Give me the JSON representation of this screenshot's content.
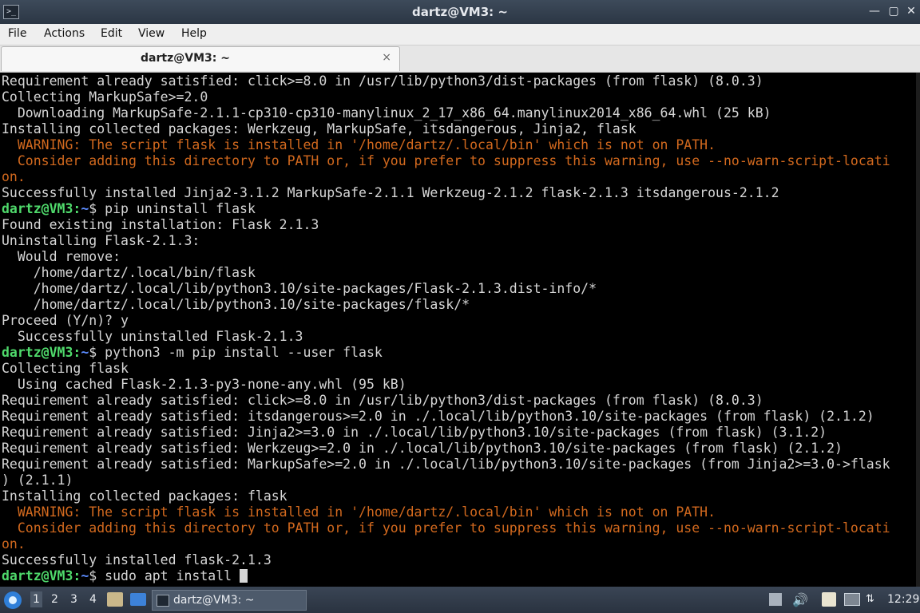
{
  "window": {
    "title": "dartz@VM3: ~",
    "minimize_label": "—",
    "maximize_label": "▢",
    "close_label": "✕"
  },
  "menu": [
    "File",
    "Actions",
    "Edit",
    "View",
    "Help"
  ],
  "tab": {
    "label": "dartz@VM3: ~",
    "close_label": "×"
  },
  "terminal": {
    "prompt_user": "dartz@VM3:",
    "prompt_path": "~",
    "lines": [
      {
        "t": "text",
        "s": "Requirement already satisfied: click>=8.0 in /usr/lib/python3/dist-packages (from flask) (8.0.3)"
      },
      {
        "t": "text",
        "s": "Collecting MarkupSafe>=2.0"
      },
      {
        "t": "text",
        "s": "  Downloading MarkupSafe-2.1.1-cp310-cp310-manylinux_2_17_x86_64.manylinux2014_x86_64.whl (25 kB)"
      },
      {
        "t": "text",
        "s": "Installing collected packages: Werkzeug, MarkupSafe, itsdangerous, Jinja2, flask"
      },
      {
        "t": "warn",
        "s": "  WARNING: The script flask is installed in '/home/dartz/.local/bin' which is not on PATH."
      },
      {
        "t": "warn",
        "s": "  Consider adding this directory to PATH or, if you prefer to suppress this warning, use --no-warn-script-locati"
      },
      {
        "t": "warn",
        "s": "on."
      },
      {
        "t": "text",
        "s": "Successfully installed Jinja2-3.1.2 MarkupSafe-2.1.1 Werkzeug-2.1.2 flask-2.1.3 itsdangerous-2.1.2"
      },
      {
        "t": "prompt",
        "s": "$ pip uninstall flask"
      },
      {
        "t": "text",
        "s": "Found existing installation: Flask 2.1.3"
      },
      {
        "t": "text",
        "s": "Uninstalling Flask-2.1.3:"
      },
      {
        "t": "text",
        "s": "  Would remove:"
      },
      {
        "t": "text",
        "s": "    /home/dartz/.local/bin/flask"
      },
      {
        "t": "text",
        "s": "    /home/dartz/.local/lib/python3.10/site-packages/Flask-2.1.3.dist-info/*"
      },
      {
        "t": "text",
        "s": "    /home/dartz/.local/lib/python3.10/site-packages/flask/*"
      },
      {
        "t": "text",
        "s": "Proceed (Y/n)? y"
      },
      {
        "t": "text",
        "s": "  Successfully uninstalled Flask-2.1.3"
      },
      {
        "t": "prompt",
        "s": "$ python3 -m pip install --user flask"
      },
      {
        "t": "text",
        "s": "Collecting flask"
      },
      {
        "t": "text",
        "s": "  Using cached Flask-2.1.3-py3-none-any.whl (95 kB)"
      },
      {
        "t": "text",
        "s": "Requirement already satisfied: click>=8.0 in /usr/lib/python3/dist-packages (from flask) (8.0.3)"
      },
      {
        "t": "text",
        "s": "Requirement already satisfied: itsdangerous>=2.0 in ./.local/lib/python3.10/site-packages (from flask) (2.1.2)"
      },
      {
        "t": "text",
        "s": "Requirement already satisfied: Jinja2>=3.0 in ./.local/lib/python3.10/site-packages (from flask) (3.1.2)"
      },
      {
        "t": "text",
        "s": "Requirement already satisfied: Werkzeug>=2.0 in ./.local/lib/python3.10/site-packages (from flask) (2.1.2)"
      },
      {
        "t": "text",
        "s": "Requirement already satisfied: MarkupSafe>=2.0 in ./.local/lib/python3.10/site-packages (from Jinja2>=3.0->flask"
      },
      {
        "t": "text",
        "s": ") (2.1.1)"
      },
      {
        "t": "text",
        "s": "Installing collected packages: flask"
      },
      {
        "t": "warn",
        "s": "  WARNING: The script flask is installed in '/home/dartz/.local/bin' which is not on PATH."
      },
      {
        "t": "warn",
        "s": "  Consider adding this directory to PATH or, if you prefer to suppress this warning, use --no-warn-script-locati"
      },
      {
        "t": "warn",
        "s": "on."
      },
      {
        "t": "text",
        "s": "Successfully installed flask-2.1.3"
      },
      {
        "t": "prompt_cursor",
        "s": "$ sudo apt install "
      }
    ]
  },
  "taskbar": {
    "workspaces": [
      "1",
      "2",
      "3",
      "4"
    ],
    "active_workspace": "1",
    "window_label": "dartz@VM3: ~",
    "clock": "12:29",
    "icons": [
      "start-menu-icon",
      "file-manager-icon",
      "show-desktop-icon",
      "terminal-icon",
      "eject-icon",
      "volume-icon",
      "clipboard-icon",
      "network-icon",
      "notification-icon"
    ]
  },
  "colors": {
    "terminal_bg": "#000000",
    "terminal_fg": "#d6d6d6",
    "warning": "#d2691e",
    "prompt_user": "#4fd96b",
    "prompt_path": "#5c8cff"
  }
}
